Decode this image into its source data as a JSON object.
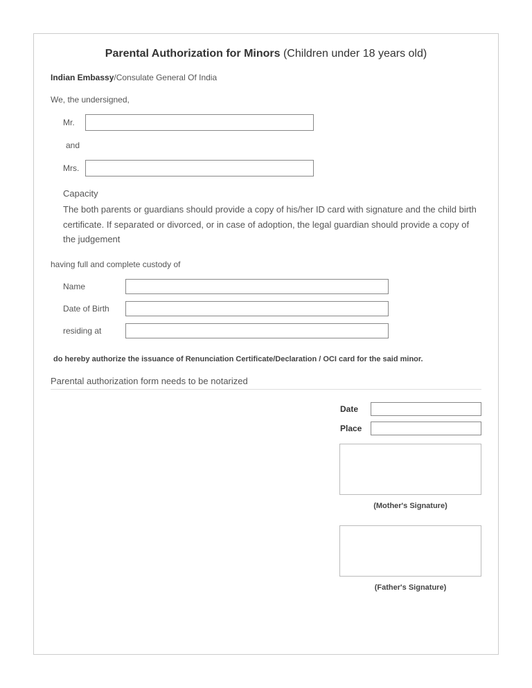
{
  "title": {
    "bold": "Parental Authorization for Minors",
    "rest": " (Children under 18 years old)"
  },
  "embassy": {
    "bold": "Indian Embassy",
    "rest": "/Consulate General Of India"
  },
  "undersigned": "We, the undersigned,",
  "parent": {
    "mr_label": "Mr.",
    "mr_value": "",
    "and_label": "and",
    "mrs_label": "Mrs.",
    "mrs_value": ""
  },
  "capacity": {
    "label": "Capacity",
    "text": "The both parents or guardians should provide a copy of his/her ID card with signature and the child birth certificate. If separated or divorced, or in case of adoption, the legal guardian should provide a copy of the judgement"
  },
  "custody_line": "having full and complete custody of",
  "child": {
    "name_label": "Name",
    "name_value": "",
    "dob_label": "Date of Birth",
    "dob_value": "",
    "residing_label": "residing at",
    "residing_value": ""
  },
  "authorize_line": "do hereby authorize the issuance of Renunciation Certificate/Declaration / OCI card for the said minor.",
  "notarized_line": "Parental authorization form needs to be notarized",
  "signature": {
    "date_label": "Date",
    "date_value": "",
    "place_label": "Place",
    "place_value": "",
    "mother_caption": "(Mother's Signature)",
    "father_caption": "(Father's Signature)"
  }
}
